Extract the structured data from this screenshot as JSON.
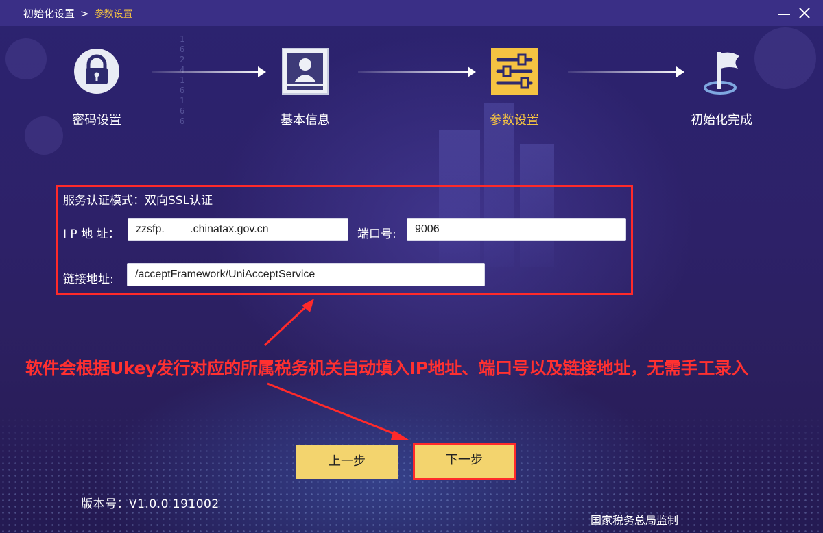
{
  "window": {
    "breadcrumb": {
      "root": "初始化设置",
      "separator": ">",
      "current": "参数设置"
    }
  },
  "steps": [
    {
      "label": "密码设置",
      "icon": "lock-icon",
      "state": "done"
    },
    {
      "label": "基本信息",
      "icon": "id-card-icon",
      "state": "done"
    },
    {
      "label": "参数设置",
      "icon": "sliders-icon",
      "state": "active"
    },
    {
      "label": "初始化完成",
      "icon": "flag-icon",
      "state": "pending"
    }
  ],
  "form": {
    "auth_mode": "服务认证模式：双向SSL认证",
    "ip_label": "I P 地 址：",
    "ip_value": "zzsfp.         .chinatax.gov.cn",
    "port_label": "端口号:",
    "port_value": "9006",
    "link_label": "链接地址:",
    "link_value": "/acceptFramework/UniAcceptService"
  },
  "annotation": {
    "text": "软件会根据Ukey发行对应的所属税务机关自动填入IP地址、端口号以及链接地址，无需手工录入",
    "color": "#ff3030"
  },
  "buttons": {
    "prev": "上一步",
    "next": "下一步"
  },
  "footer": {
    "version": "版本号：V1.0.0 191002",
    "org": "国家税务总局监制"
  },
  "colors": {
    "accent": "#f5c342",
    "button": "#f3d46e",
    "highlight": "#ff2a2a",
    "titlebar": "#3a2f86"
  }
}
